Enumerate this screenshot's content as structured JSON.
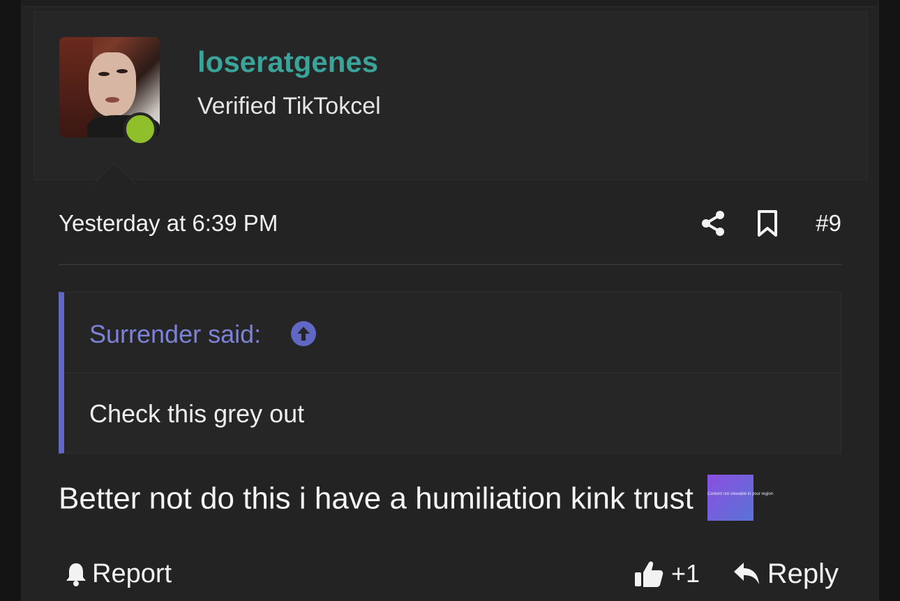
{
  "user": {
    "username": "loseratgenes",
    "title": "Verified TikTokcel",
    "status": "online"
  },
  "post": {
    "timestamp": "Yesterday at 6:39 PM",
    "number": "#9",
    "message": "Better not do this i have a humiliation kink trust",
    "emoji_caption": "Content not viewable in your region"
  },
  "quote": {
    "author_label": "Surrender said:",
    "text": "Check this grey out"
  },
  "actions": {
    "report_label": "Report",
    "like_count": "+1",
    "reply_label": "Reply"
  },
  "icons": [
    "share-icon",
    "bookmark-icon",
    "arrow-up-circle-icon",
    "bell-icon",
    "thumbs-up-icon",
    "reply-arrow-icon"
  ],
  "colors": {
    "username": "#3aa39a",
    "quote_accent": "#6168c4",
    "online": "#8fbf2a"
  }
}
